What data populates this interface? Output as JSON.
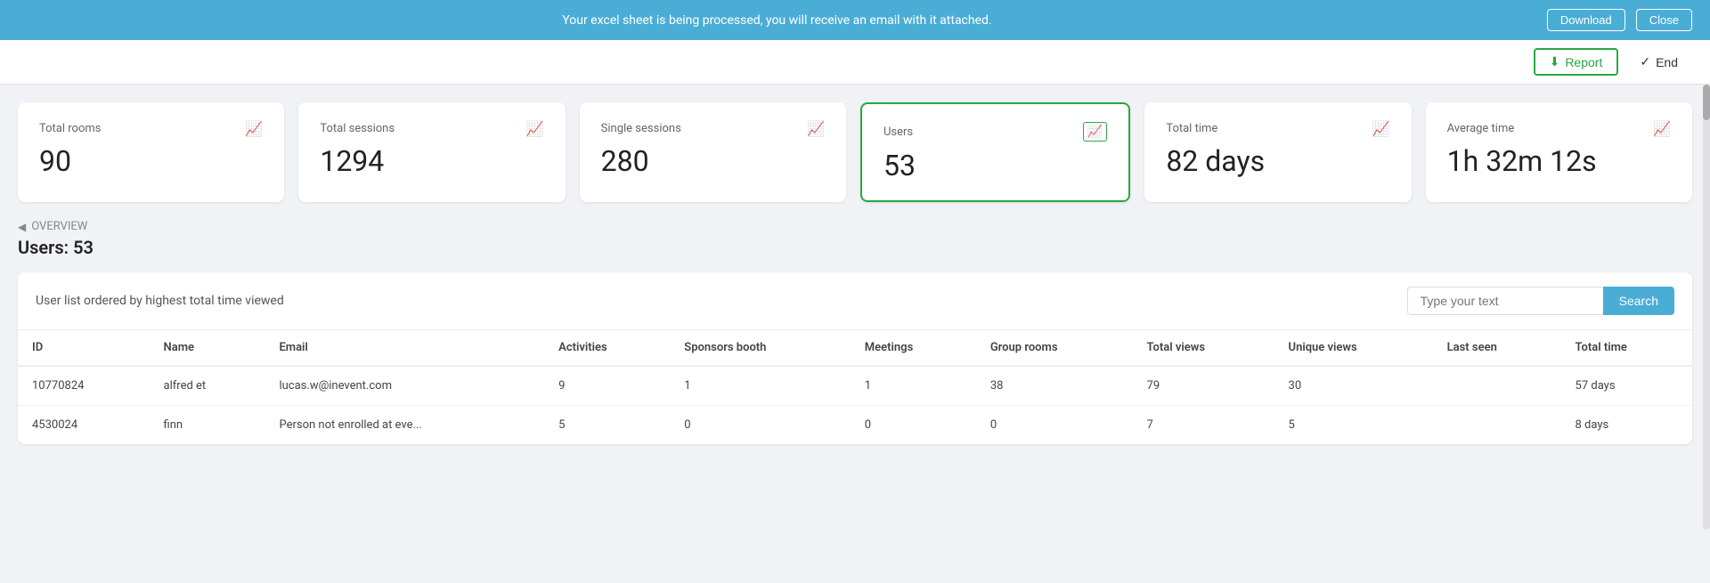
{
  "notification": {
    "message": "Your excel sheet is being processed, you will receive an email with it attached.",
    "download_label": "Download",
    "close_label": "Close"
  },
  "toolbar": {
    "report_label": "Report",
    "end_label": "End"
  },
  "stats": [
    {
      "id": "total-rooms",
      "label": "Total rooms",
      "value": "90"
    },
    {
      "id": "total-sessions",
      "label": "Total sessions",
      "value": "1294"
    },
    {
      "id": "single-sessions",
      "label": "Single sessions",
      "value": "280"
    },
    {
      "id": "users",
      "label": "Users",
      "value": "53",
      "active": true
    },
    {
      "id": "total-time",
      "label": "Total time",
      "value": "82 days"
    },
    {
      "id": "average-time",
      "label": "Average time",
      "value": "1h 32m 12s"
    }
  ],
  "breadcrumb": {
    "back_label": "OVERVIEW"
  },
  "page_heading": "Users: 53",
  "table": {
    "title": "User list ordered by highest total time viewed",
    "search_placeholder": "Type your text",
    "search_label": "Search",
    "columns": [
      "ID",
      "Name",
      "Email",
      "Activities",
      "Sponsors booth",
      "Meetings",
      "Group rooms",
      "Total views",
      "Unique views",
      "Last seen",
      "Total time"
    ],
    "rows": [
      {
        "id": "10770824",
        "name": "alfred et",
        "email": "lucas.w@inevent.com",
        "activities": "9",
        "sponsors_booth": "1",
        "meetings": "1",
        "group_rooms": "38",
        "total_views": "79",
        "unique_views": "30",
        "last_seen": "",
        "total_time": "57 days"
      },
      {
        "id": "4530024",
        "name": "finn",
        "email": "Person not enrolled at eve...",
        "activities": "5",
        "sponsors_booth": "0",
        "meetings": "0",
        "group_rooms": "0",
        "total_views": "7",
        "unique_views": "5",
        "last_seen": "",
        "total_time": "8 days"
      }
    ]
  },
  "icons": {
    "chart": "📈",
    "download_icon": "⬇",
    "check_icon": "✓",
    "back_arrow": "◀"
  },
  "colors": {
    "accent_blue": "#4aadd6",
    "accent_green": "#28a745",
    "notification_bg": "#4aadd6"
  }
}
